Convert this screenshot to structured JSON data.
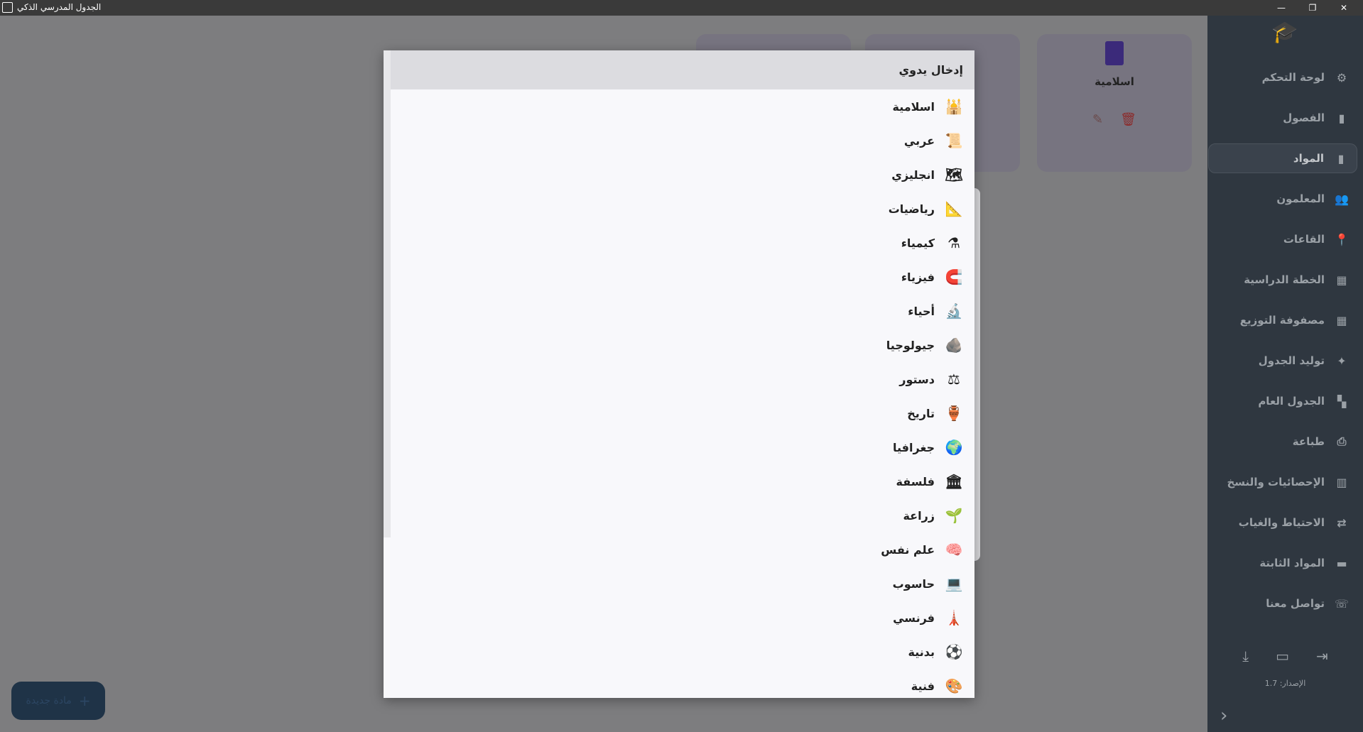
{
  "window": {
    "title": "الجدول المدرسي الذكي",
    "controls": [
      "—",
      "❐",
      "✕"
    ]
  },
  "background_card": {
    "name": "اسلامية",
    "delete_icon": "trash-icon",
    "edit_icon": "pencil-icon"
  },
  "fab": {
    "label": "مادة جديدة",
    "icon": "plus-icon"
  },
  "sidebar": {
    "logo_icon": "graduation-cap-icon",
    "items": [
      {
        "label": "لوحة التحكم",
        "icon": "⚙"
      },
      {
        "label": "الفصول",
        "icon": "▮"
      },
      {
        "label": "المواد",
        "icon": "▮"
      },
      {
        "label": "المعلمون",
        "icon": "👥"
      },
      {
        "label": "القاعات",
        "icon": "📍"
      },
      {
        "label": "الخطة الدراسية",
        "icon": "▦"
      },
      {
        "label": "مصفوفة التوزيع",
        "icon": "▦"
      },
      {
        "label": "توليد الجدول",
        "icon": "✦"
      },
      {
        "label": "الجدول العام",
        "icon": "▚"
      },
      {
        "label": "طباعة",
        "icon": "⎙"
      },
      {
        "label": "الإحصائيات والنسخ",
        "icon": "▥"
      },
      {
        "label": "الاحتياط والغياب",
        "icon": "⇄"
      },
      {
        "label": "المواد الثابتة",
        "icon": "▬"
      },
      {
        "label": "تواصل معنا",
        "icon": "☏"
      }
    ],
    "active_index": 2,
    "bottom_icons": [
      "⤓",
      "▭",
      "⇥"
    ],
    "version": "الإصدار: 1.7",
    "collapse_icon": "›"
  },
  "dropdown": {
    "header": "إدخال يدوي",
    "options": [
      {
        "label": "اسلامية",
        "icon": "🕌"
      },
      {
        "label": "عربي",
        "icon": "📜"
      },
      {
        "label": "انجليزي",
        "icon": "🗺"
      },
      {
        "label": "رياضيات",
        "icon": "📐"
      },
      {
        "label": "كيمياء",
        "icon": "⚗"
      },
      {
        "label": "فيزياء",
        "icon": "🧲"
      },
      {
        "label": "أحياء",
        "icon": "🔬"
      },
      {
        "label": "جيولوجيا",
        "icon": "🪨"
      },
      {
        "label": "دستور",
        "icon": "⚖"
      },
      {
        "label": "تاريخ",
        "icon": "🏺"
      },
      {
        "label": "جغرافيا",
        "icon": "🌍"
      },
      {
        "label": "فلسفة",
        "icon": "🏛"
      },
      {
        "label": "زراعة",
        "icon": "🌱"
      },
      {
        "label": "علم نفس",
        "icon": "🧠"
      },
      {
        "label": "حاسوب",
        "icon": "💻"
      },
      {
        "label": "فرنسي",
        "icon": "🗼"
      },
      {
        "label": "بدنية",
        "icon": "⚽"
      },
      {
        "label": "فنية",
        "icon": "🎨"
      }
    ]
  }
}
